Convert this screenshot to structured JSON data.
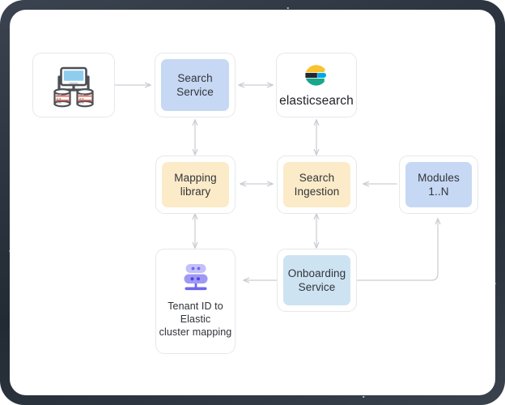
{
  "diagram": {
    "title": "Search architecture diagram",
    "frame": {
      "border_style": "dark-speckled-rounded",
      "background": "#ffffff"
    },
    "colors": {
      "box_border": "#e6e8ea",
      "fill_blue": "#c6d8f3",
      "fill_yellow": "#fcebc8",
      "fill_cyan": "#cde3f2",
      "arrow": "#c9cdd2",
      "text": "#32343a",
      "es_yellow": "#f9c22e",
      "es_dark": "#23292f",
      "es_blue": "#00a9e5",
      "es_teal": "#17a78b",
      "server_icon_light": "#c3c1f7",
      "server_icon_dark": "#7b74f1",
      "monitor_screen": "#8ecdee"
    },
    "nodes": [
      {
        "id": "client",
        "label": "",
        "icon": "computer-database-icon",
        "fill": "none"
      },
      {
        "id": "search-service",
        "label": "Search\nService",
        "fill": "#c6d8f3"
      },
      {
        "id": "elasticsearch",
        "label": "elasticsearch",
        "icon": "elasticsearch-logo",
        "fill": "none"
      },
      {
        "id": "mapping-library",
        "label": "Mapping\nlibrary",
        "fill": "#fcebc8"
      },
      {
        "id": "search-ingestion",
        "label": "Search\nIngestion",
        "fill": "#fcebc8"
      },
      {
        "id": "modules",
        "label": "Modules\n1..N",
        "fill": "#c6d8f3"
      },
      {
        "id": "tenant-mapping",
        "label": "Tenant ID to\nElastic\ncluster mapping",
        "icon": "server-rack-icon",
        "fill": "none"
      },
      {
        "id": "onboarding-service",
        "label": "Onboarding\nService",
        "fill": "#cde3f2"
      }
    ],
    "connectors": [
      {
        "id": "client-to-search-service",
        "from": "client",
        "to": "search-service",
        "direction": "one-way"
      },
      {
        "id": "search-service-to-elasticsearch",
        "from": "search-service",
        "to": "elasticsearch",
        "direction": "two-way"
      },
      {
        "id": "search-service-to-mapping-library",
        "from": "search-service",
        "to": "mapping-library",
        "direction": "two-way"
      },
      {
        "id": "elasticsearch-to-search-ingestion",
        "from": "elasticsearch",
        "to": "search-ingestion",
        "direction": "two-way"
      },
      {
        "id": "mapping-library-to-search-ingestion",
        "from": "mapping-library",
        "to": "search-ingestion",
        "direction": "two-way"
      },
      {
        "id": "modules-to-search-ingestion",
        "from": "modules",
        "to": "search-ingestion",
        "direction": "one-way"
      },
      {
        "id": "mapping-library-to-tenant-mapping",
        "from": "mapping-library",
        "to": "tenant-mapping",
        "direction": "two-way"
      },
      {
        "id": "search-ingestion-to-onboarding",
        "from": "search-ingestion",
        "to": "onboarding-service",
        "direction": "two-way"
      },
      {
        "id": "onboarding-to-tenant-mapping",
        "from": "onboarding-service",
        "to": "tenant-mapping",
        "direction": "one-way"
      },
      {
        "id": "onboarding-to-modules",
        "from": "onboarding-service",
        "to": "modules",
        "direction": "one-way"
      }
    ],
    "labels": {
      "client": "",
      "search_service": "Search\nService",
      "elasticsearch": "elasticsearch",
      "mapping_library": "Mapping\nlibrary",
      "search_ingestion": "Search\nIngestion",
      "modules": "Modules\n1..N",
      "tenant_mapping": "Tenant ID to\nElastic\ncluster mapping",
      "onboarding_service": "Onboarding\nService"
    }
  }
}
